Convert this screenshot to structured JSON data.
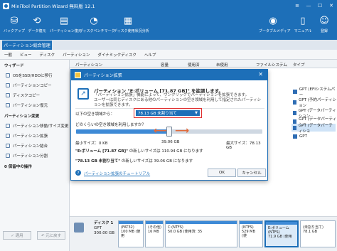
{
  "window": {
    "title": "MiniTool Partition Wizard 無料版 12.1",
    "controls": [
      "≡",
      "—",
      "☐",
      "✕"
    ]
  },
  "toolbar": {
    "items": [
      {
        "label": "バックアップ",
        "icon": "backup-icon"
      },
      {
        "label": "データ復元",
        "icon": "data-recovery-icon"
      },
      {
        "label": "パーティション復元",
        "icon": "partition-recovery-icon"
      },
      {
        "label": "ディスクベンチマーク",
        "icon": "disk-benchmark-icon"
      },
      {
        "label": "ディスク使用状況分析",
        "icon": "space-analyzer-icon"
      },
      {
        "label": "ブータブルメディア",
        "icon": "bootable-media-icon"
      },
      {
        "label": "マニュアル",
        "icon": "manual-icon"
      },
      {
        "label": "登録",
        "icon": "register-icon"
      }
    ]
  },
  "tab": {
    "active": "パーティション総合管理"
  },
  "menu": [
    "一般",
    "ビュー",
    "ディスク",
    "パーティション",
    "ダイナミックディスク",
    "ヘルプ"
  ],
  "sidebar": {
    "wizard_header": "ウィザード",
    "wizard_items": [
      "OSをSSD/HDDに移行",
      "パーティションコピー",
      "ディスクコピー",
      "パーティション復元"
    ],
    "change_header": "パーティション変更",
    "change_items": [
      "パーティション移動/サイズ変更",
      "パーティション拡張",
      "パーティション結合",
      "パーティション分割"
    ],
    "pending": "0 保留中の操作",
    "apply": "✓ 適用",
    "undo": "↶ 元に戻す"
  },
  "table": {
    "headers": [
      "パーティション",
      "容量",
      "使用済",
      "未使用",
      "ファイルシステム",
      "タイプ"
    ],
    "types": [
      "GPT (EFIシステムパー",
      "GPT (予約パーティション",
      "GPT (データパーティション",
      "GPT (データパーティショ",
      "GPT (データパーティショ",
      "GPT"
    ]
  },
  "diskmap": {
    "disk_name": "ディスク 1",
    "disk_type": "GPT",
    "disk_size": "300.00 GB",
    "partitions": [
      {
        "name": "(FAT32)",
        "size": "100 MB (使用"
      },
      {
        "name": "(その他)",
        "size": "16 MB"
      },
      {
        "name": "C:(NTFS)",
        "size": "50.0 GB (使用済: 35"
      },
      {
        "name": "(NTFS)",
        "size": "529 MB (使"
      },
      {
        "name": "E:ボリューム(NTFS)",
        "size": "71.9 GB (使用"
      },
      {
        "name": "(未割り当て)",
        "size": "78.1 GB"
      }
    ]
  },
  "dialog": {
    "title": "パーティション拡張",
    "heading": "パーティション \"E:ボリューム [71.87 GB]\" を拡張します。",
    "desc1": "「パーティション拡張」機能によって、ワンクリックでパーティションを拡張できます。",
    "desc2": "ユーザーは同じディスクにある他のパーティションの空き領域を利用して指定されたパーティションを拡張できます。",
    "take_label": "以下の空き領域から：",
    "select_value": "78.13 GB 未割り当て",
    "how_label": "どのくらいの空き領域を利用しますか？",
    "min_label": "最小サイズ：0 KB",
    "mid_label": "39.06 GB",
    "max_label": "最大サイズ：78.13 GB",
    "new_e_label": "\"E:ボリューム [71.87 GB]\"",
    "new_e_value": "の新しいサイズは 110.94 GB になります",
    "new_u_label": "\"78.13 GB 未割り当て\"",
    "new_u_value": "の新しいサイズは 39.06 GB になります",
    "help_link": "パーティション拡張のチュートリアル",
    "ok": "OK",
    "cancel": "キャンセル",
    "slider_fraction": 0.5
  },
  "colors": {
    "accent": "#1d6fb8",
    "arrow": "#e06a3b",
    "highlight": "#e03030"
  }
}
